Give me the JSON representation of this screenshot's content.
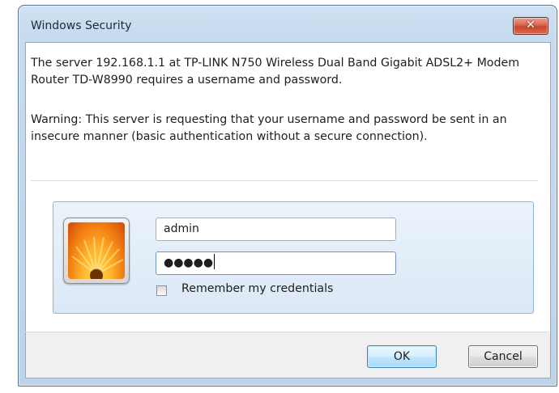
{
  "window": {
    "title": "Windows Security",
    "close_symbol": "✕"
  },
  "message": {
    "line1": "The server 192.168.1.1 at TP-LINK N750 Wireless Dual Band Gigabit ADSL2+ Modem Router TD-W8990 requires a username and password.",
    "warning": "Warning: This server is requesting that your username and password be sent in an insecure manner (basic authentication without a secure connection)."
  },
  "credentials": {
    "avatar_icon": "user-flower-picture-icon",
    "username_value": "admin",
    "password_masked": "●●●●●",
    "remember_label": "Remember my credentials",
    "remember_checked": false
  },
  "buttons": {
    "ok_label": "OK",
    "cancel_label": "Cancel"
  }
}
